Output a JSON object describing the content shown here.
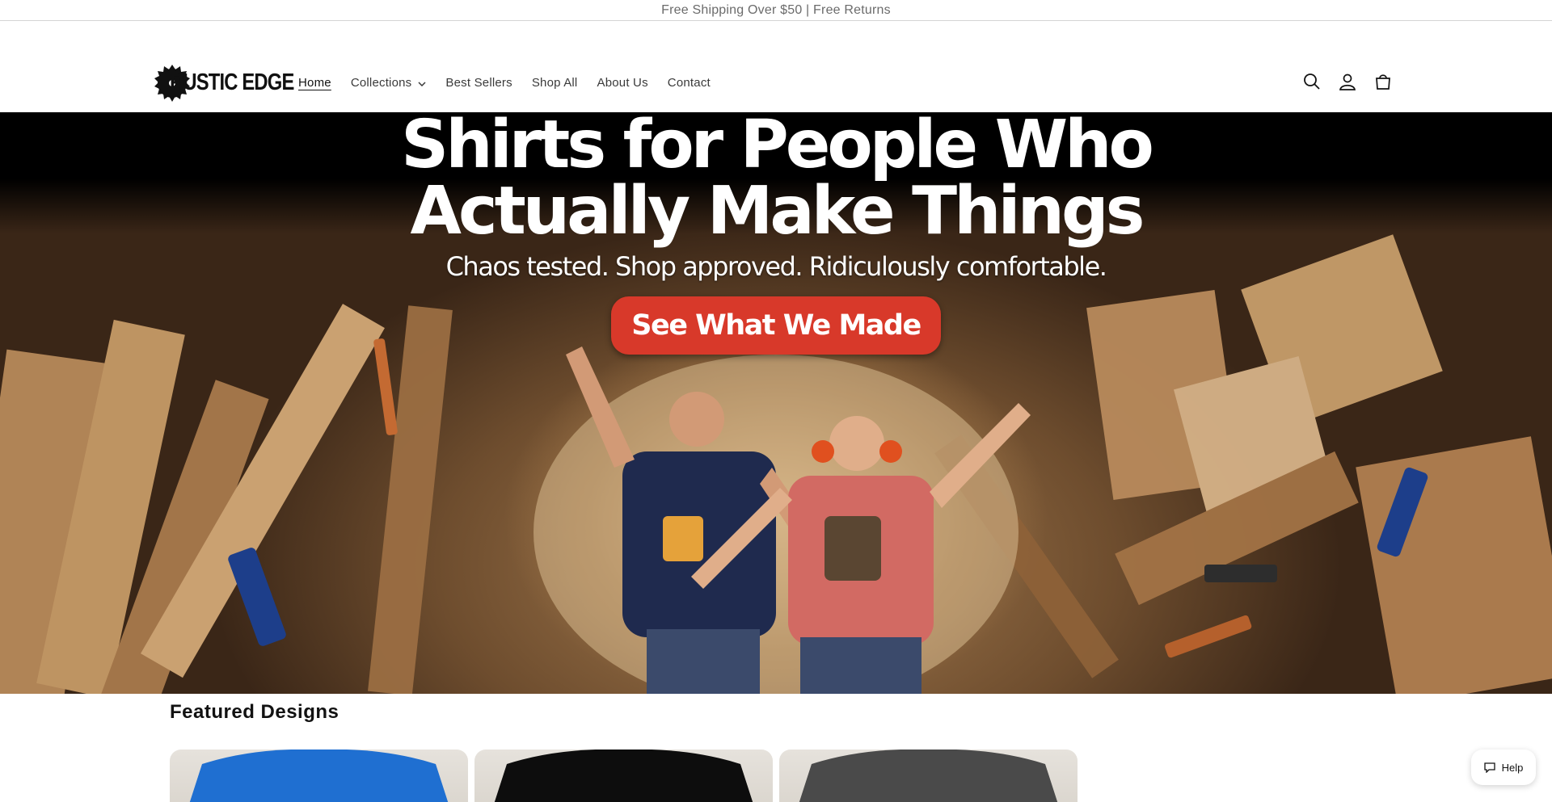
{
  "announcement": {
    "text": "Free Shipping Over $50 | Free Returns"
  },
  "header": {
    "logo_text": "RUSTIC EDGE",
    "nav": [
      {
        "label": "Home",
        "active": true
      },
      {
        "label": "Collections",
        "has_dropdown": true
      },
      {
        "label": "Best Sellers"
      },
      {
        "label": "Shop All"
      },
      {
        "label": "About Us"
      },
      {
        "label": "Contact"
      }
    ],
    "icons": [
      "search-icon",
      "account-icon",
      "cart-icon"
    ]
  },
  "hero": {
    "title_line1": "Shirts for People Who",
    "title_line2": "Actually Make Things",
    "subtitle": "Chaos tested. Shop approved. Ridiculously comfortable.",
    "cta_label": "See What We Made",
    "cta_color": "#d8392a"
  },
  "featured": {
    "title": "Featured Designs",
    "cards": [
      {
        "shirt_color": "#1f6fd1"
      },
      {
        "shirt_color": "#0d0d0d"
      },
      {
        "shirt_color": "#4a4a4a"
      }
    ]
  },
  "help_widget": {
    "label": "Help"
  }
}
